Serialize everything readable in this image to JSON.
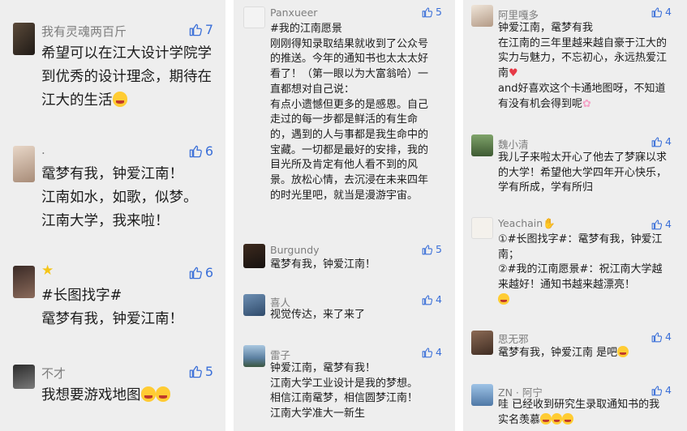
{
  "columns": [
    {
      "id": "left",
      "comments": [
        {
          "username": "我有灵魂两百斤",
          "likes": "7",
          "avatar": "avatar-photo-dark",
          "text_before": "希望可以在江大设计学院学到优秀的设计理念，期待在江大的生活",
          "emoji": "smile-emoji",
          "text_after": ""
        },
        {
          "username": ".",
          "likes": "6",
          "avatar": "avatar-photo-girl",
          "text_before": "鼋梦有我，钟爱江南！\n江南如水，如歌，似梦。\n江南大学，我来啦！",
          "emoji": "",
          "text_after": ""
        },
        {
          "username": "",
          "likes": "6",
          "avatar": "avatar-photo-woman",
          "text_before": "#长图找字#\n鼋梦有我，钟爱江南！",
          "emoji": "",
          "text_after": ""
        },
        {
          "username": "不才",
          "likes": "5",
          "avatar": "avatar-photo-gray",
          "text_before": "我想要游戏地图",
          "emoji": "star-eyes-emoji",
          "text_after": ""
        }
      ]
    },
    {
      "id": "middle",
      "comments": [
        {
          "username": "Panxueer",
          "likes": "5",
          "avatar": "avatar-cartoon",
          "text_before": "#我的江南愿景\n刚刚得知录取结果就收到了公众号的推送。今年的通知书也太太太好看了！（第一眼以为大富翁哈）一直都想对自己说：\n有点小遗憾但更多的是感恩。自己走过的每一步都是鲜活的有生命的，遇到的人与事都是我生命中的宝藏。一切都是最好的安排，我的目光所及肯定有他人看不到的风景。放松心情，去沉浸在未来四年的时光里吧，就当是漫游宇宙。",
          "emoji": "",
          "text_after": ""
        },
        {
          "username": "Burgundy",
          "likes": "5",
          "avatar": "avatar-dark-square",
          "text_before": "鼋梦有我，钟爱江南！",
          "emoji": "",
          "text_after": ""
        },
        {
          "username": "喜人",
          "likes": "4",
          "avatar": "avatar-cartoon-blue",
          "text_before": "视觉传达，来了来了",
          "emoji": "",
          "text_after": ""
        },
        {
          "username": "雷子",
          "likes": "4",
          "avatar": "avatar-landscape",
          "text_before": "钟爱江南，鼋梦有我！\n江南大学工业设计是我的梦想。\n相信江南鼋梦，相信圆梦江南！\n江南大学准大一新生",
          "emoji": "",
          "text_after": ""
        }
      ]
    },
    {
      "id": "right",
      "comments": [
        {
          "username": "阿里嘎多",
          "likes": "4",
          "avatar": "avatar-photo-light",
          "text_before": "钟爱江南，鼋梦有我\n在江南的三年里越来越自豪于江大的实力与魅力，不忘初心，永远热爱江南",
          "emoji": "heart-emoji",
          "text_after": "\nand好喜欢这个卡通地图呀，不知道有没有机会得到呢",
          "emoji2": "flower-emoji"
        },
        {
          "username": "魏小清",
          "likes": "4",
          "avatar": "avatar-landscape-green",
          "text_before": "我儿子来啦太开心了他去了梦寐以求的大学！希望他大学四年开心快乐，学有所成，学有所归",
          "emoji": "",
          "text_after": ""
        },
        {
          "username": "Yeachain",
          "likes": "4",
          "avatar": "avatar-cartoon-boy",
          "text_before": "①#长图找字#：鼋梦有我，钟爱江南；\n②#我的江南愿景#：祝江南大学越来越好！通知书越来越漂亮！",
          "emoji": "grin-emoji",
          "text_after": ""
        },
        {
          "username": "思无邪",
          "likes": "4",
          "avatar": "avatar-photo-brown",
          "text_before": "鼋梦有我，钟爱江南 是吧",
          "emoji": "wink-emoji",
          "text_after": ""
        },
        {
          "username": "ZN · 阿宁",
          "likes": "4",
          "avatar": "avatar-photo-blue",
          "text_before": "哇 已经收到研究生录取通知书的我实名羡慕",
          "emoji": "cry-emoji",
          "text_after": ""
        }
      ]
    }
  ],
  "colors": {
    "like": "#3a6fd8",
    "name": "#7d7d7d",
    "text": "#1c1c1c",
    "panel": "#eeeeee"
  }
}
